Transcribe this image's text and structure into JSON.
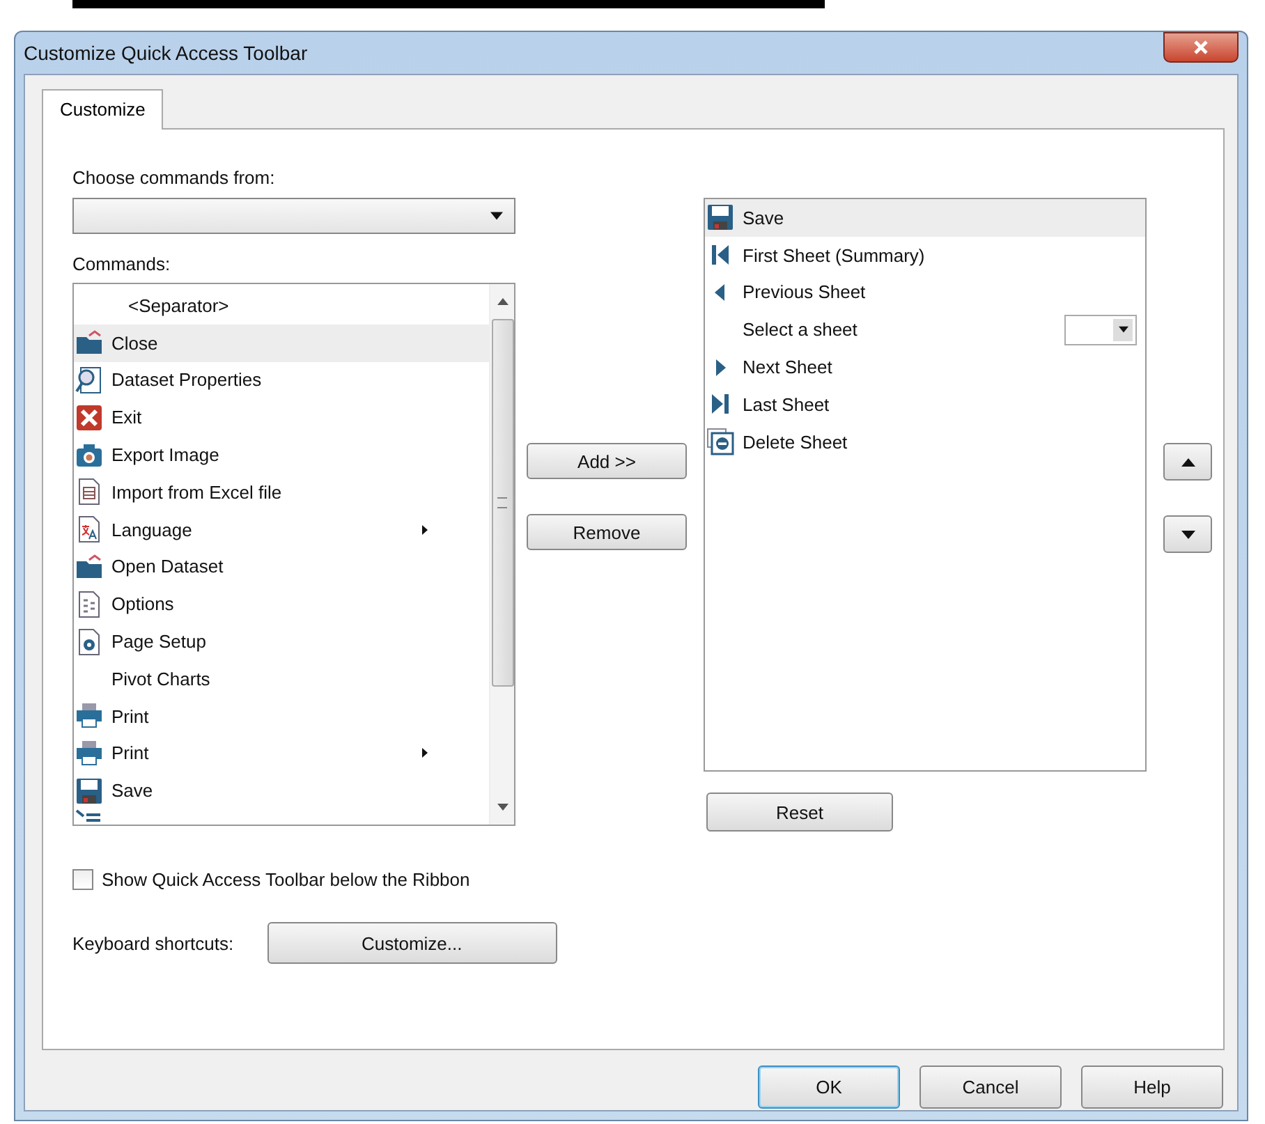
{
  "window": {
    "title": "Customize Quick Access Toolbar"
  },
  "tabs": [
    {
      "label": "Customize",
      "selected": true
    }
  ],
  "choose_commands": {
    "label": "Choose commands from:"
  },
  "commands": {
    "label": "Commands:",
    "items": [
      {
        "label": "<Separator>",
        "kind": "separator",
        "selected": false,
        "has_submenu": false
      },
      {
        "label": "Close",
        "kind": "close",
        "selected": true,
        "has_submenu": false
      },
      {
        "label": "Dataset Properties",
        "kind": "properties",
        "selected": false,
        "has_submenu": false
      },
      {
        "label": "Exit",
        "kind": "exit",
        "selected": false,
        "has_submenu": false
      },
      {
        "label": "Export Image",
        "kind": "camera",
        "selected": false,
        "has_submenu": false
      },
      {
        "label": "Import from Excel file",
        "kind": "sheet",
        "selected": false,
        "has_submenu": false
      },
      {
        "label": "Language",
        "kind": "language",
        "selected": false,
        "has_submenu": true
      },
      {
        "label": "Open Dataset",
        "kind": "folder",
        "selected": false,
        "has_submenu": false
      },
      {
        "label": "Options",
        "kind": "options",
        "selected": false,
        "has_submenu": false
      },
      {
        "label": "Page Setup",
        "kind": "gear",
        "selected": false,
        "has_submenu": false
      },
      {
        "label": "Pivot Charts",
        "kind": "plain",
        "selected": false,
        "has_submenu": false
      },
      {
        "label": "Print",
        "kind": "printer",
        "selected": false,
        "has_submenu": false
      },
      {
        "label": "Print",
        "kind": "printer",
        "selected": false,
        "has_submenu": true
      },
      {
        "label": "Save",
        "kind": "save",
        "selected": false,
        "has_submenu": false
      }
    ]
  },
  "middle_buttons": [
    "Add >>",
    "Remove"
  ],
  "toolbar_commands": [
    {
      "label": "Save",
      "kind": "save",
      "selected": true
    },
    {
      "label": "First Sheet (Summary)",
      "kind": "first",
      "selected": false
    },
    {
      "label": "Previous Sheet",
      "kind": "prev",
      "selected": false
    },
    {
      "label": "Select a sheet",
      "kind": "combo",
      "selected": false
    },
    {
      "label": "Next Sheet",
      "kind": "next",
      "selected": false
    },
    {
      "label": "Last Sheet",
      "kind": "last",
      "selected": false
    },
    {
      "label": "Delete Sheet",
      "kind": "delete",
      "selected": false
    }
  ],
  "reset_button": "Reset",
  "show_below_ribbon": {
    "label": "Show Quick Access Toolbar below the Ribbon",
    "checked": false
  },
  "keyboard_shortcuts": {
    "label": "Keyboard shortcuts:",
    "button": "Customize..."
  },
  "footer_buttons": [
    {
      "label": "OK",
      "default": true
    },
    {
      "label": "Cancel",
      "default": false
    },
    {
      "label": "Help",
      "default": false
    }
  ]
}
